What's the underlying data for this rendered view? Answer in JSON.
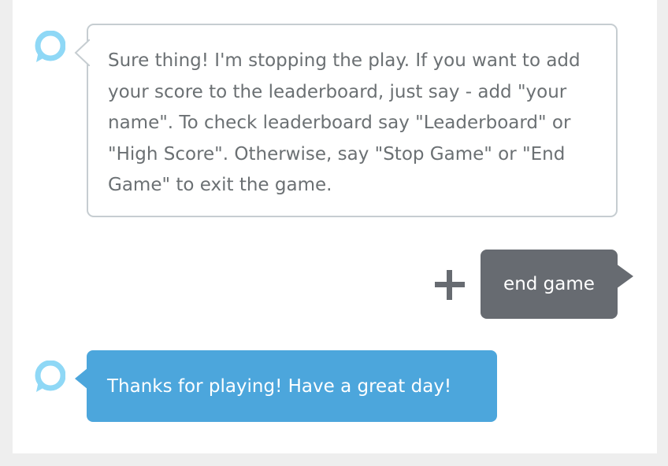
{
  "conversation": {
    "messages": [
      {
        "speaker": "alexa",
        "text": "Sure thing! I'm stopping the play. If you want to add your score to the leaderboard, just say - add \"your name\". To check leaderboard say \"Leaderboard\" or \"High Score\". Otherwise, say \"Stop Game\" or \"End Game\" to exit the game."
      },
      {
        "speaker": "user",
        "text": "end game"
      },
      {
        "speaker": "alexa",
        "text": "Thanks for playing! Have a great day!"
      }
    ]
  },
  "icons": {
    "assistant": "alexa-ring-icon",
    "add": "plus-icon"
  },
  "colors": {
    "alexa_ring": "#8fd8f6",
    "alexa_bubble_border": "#c6cdd1",
    "alexa_text": "#6b7073",
    "user_bubble": "#676b71",
    "alexa_highlight_bubble": "#4ca6dc",
    "plus_icon": "#676b71"
  }
}
